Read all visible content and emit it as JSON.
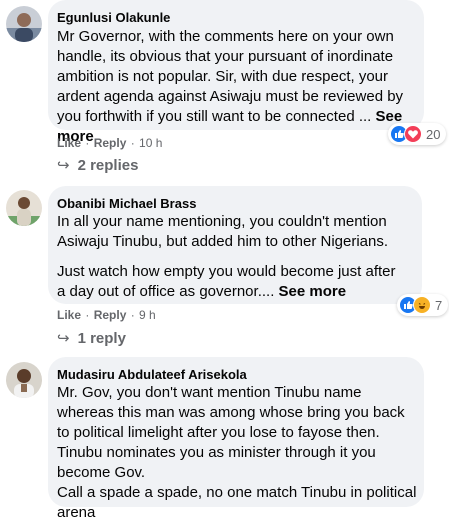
{
  "comments": [
    {
      "author": "Egunlusi Olakunle",
      "text": "Mr Governor, with the comments here on your own handle, its obvious that your pursuant of inordinate ambition is not popular. Sir, with due respect, your ardent agenda against Asiwaju must be reviewed by you forthwith if you still want to be connected ... ",
      "see_more": "See more",
      "like": "Like",
      "reply": "Reply",
      "time": "10 h",
      "reaction_count": "20",
      "reaction_icons": [
        "like-icon",
        "love-icon"
      ],
      "replies_label": "2 replies"
    },
    {
      "author": "Obanibi Michael Brass",
      "paragraph1": "In all your name mentioning, you couldn't mention Asiwaju Tinubu, but added him to other Nigerians.",
      "paragraph2": "Just watch how empty you would become just after a day out of office as governor.... ",
      "see_more": "See more",
      "like": "Like",
      "reply": "Reply",
      "time": "9 h",
      "reaction_count": "7",
      "reaction_icons": [
        "like-icon",
        "haha-icon"
      ],
      "replies_label": "1 reply"
    },
    {
      "author": "Mudasiru Abdulateef Arisekola",
      "paragraph1": "Mr. Gov, you don't want mention Tinubu name whereas this man was among whose bring you back to political limelight after you lose to fayose then. Tinubu nominates you as minister through it you become Gov.",
      "paragraph2": "Call a spade a spade, no one match Tinubu in political arena"
    }
  ],
  "colors": {
    "bubble": "#f0f2f5",
    "secondary_text": "#65676b",
    "like_blue": "#1877f2",
    "love_red": "#f33e58",
    "haha_yellow": "#f7b125"
  }
}
